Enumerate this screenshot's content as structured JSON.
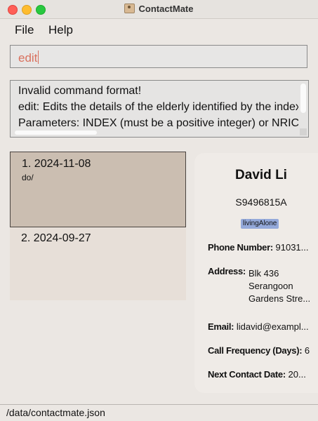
{
  "window": {
    "title": "ContactMate"
  },
  "menu": {
    "items": [
      "File",
      "Help"
    ]
  },
  "command": {
    "value": "edit"
  },
  "result": {
    "lines": [
      "Invalid command format!",
      "edit: Edits the details of the elderly identified by the index",
      "Parameters: INDEX (must be a positive integer) or NRIC"
    ]
  },
  "calls": [
    {
      "label": "1. 2024-11-08",
      "note": "do/"
    },
    {
      "label": "2. 2024-09-27",
      "note": ""
    }
  ],
  "person": {
    "name": "David Li",
    "nric": "S9496815A",
    "tag": "livingAlone",
    "phone_label": "Phone Number:",
    "phone_value": "91031...",
    "address_label": "Address:",
    "address_lines": [
      "Blk 436",
      "Serangoon",
      "Gardens Stre..."
    ],
    "email_label": "Email:",
    "email_value": "lidavid@exampl...",
    "frequency_label": "Call Frequency (Days):",
    "frequency_value": "6",
    "next_label": "Next Contact Date:",
    "next_value": "20..."
  },
  "status": {
    "path": "/data/contactmate.json"
  },
  "colors": {
    "accent_command": "#d9715e",
    "tag_bg": "#94a9da",
    "selected_bg": "#cbbeb1"
  }
}
